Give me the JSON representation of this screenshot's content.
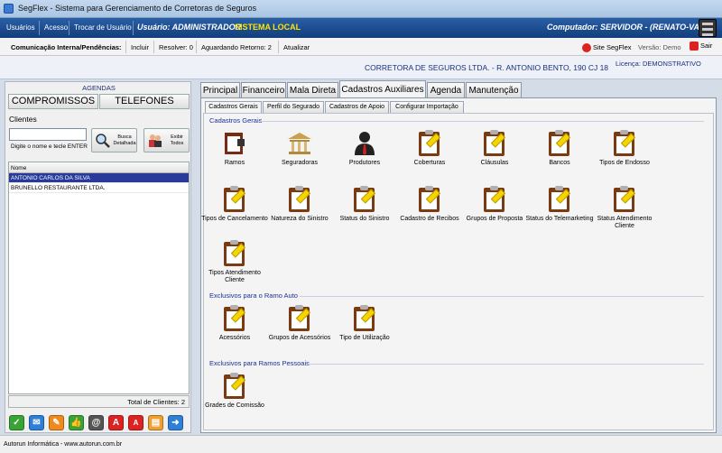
{
  "window": {
    "title": "SegFlex - Sistema para Gerenciamento de Corretoras de Seguros"
  },
  "menu": {
    "items": [
      "Usuários",
      "Acesso",
      "Trocar de Usuário"
    ],
    "user": "Usuário: ADMINISTRADOR",
    "system": "SISTEMA LOCAL",
    "computer": "Computador: SERVIDOR - (RENATO-VAIO)"
  },
  "toolbar": {
    "comm": "Comunicação Interna/Pendências:",
    "incluir": "Incluir",
    "resolver": "Resolver: 0",
    "aguardando": "Aguardando Retorno: 2",
    "atualizar": "Atualizar",
    "site": "Site SegFlex",
    "versao": "Versão: Demo",
    "sair": "Sair"
  },
  "info": {
    "company": "CORRETORA DE SEGUROS LTDA. - R. ANTONIO BENTO, 190 CJ 18",
    "license": "Licença: DEMONSTRATIVO"
  },
  "left": {
    "agendas": "AGENDAS",
    "compromissos": "COMPROMISSOS",
    "telefones": "TELEFONES",
    "clientes": "Clientes",
    "search_hint": "Digite o nome e tecle ENTER",
    "busca": "Busca Detalhada",
    "exibir": "Exibir Todos",
    "col_nome": "Nome",
    "rows": [
      "ANTONIO CARLOS DA SILVA",
      "BRUNELLO RESTAURANTE LTDA."
    ],
    "total": "Total de Clientes: 2"
  },
  "tabs": [
    "Principal",
    "Financeiro",
    "Mala Direta",
    "Cadastros Auxiliares",
    "Agenda",
    "Manutenção"
  ],
  "subtabs": [
    "Cadastros Gerais",
    "Perfil do Segurado",
    "Cadastros de Apoio",
    "Configurar Importação"
  ],
  "sections": {
    "gerais": "Cadastros Gerais",
    "auto": "Exclusivos para o Ramo Auto",
    "pessoais": "Exclusivos para Ramos Pessoais"
  },
  "items": {
    "ramos": "Ramos",
    "seguradoras": "Seguradoras",
    "produtores": "Produtores",
    "coberturas": "Coberturas",
    "clausulas": "Cláusulas",
    "bancos": "Bancos",
    "tipos_endosso": "Tipos de Endosso",
    "tipos_cancel": "Tipos de Cancelamento",
    "natureza": "Natureza do Sinistro",
    "status_sinistro": "Status do Sinistro",
    "cad_recibos": "Cadastro de Recibos",
    "grupos_proposta": "Grupos de Proposta",
    "status_tele": "Status do Telemarketing",
    "status_atend": "Status Atendimento Cliente",
    "tipos_atend": "Tipos Atendimento Cliente",
    "acessorios": "Acessórios",
    "grupos_acess": "Grupos de Acessórios",
    "tipo_util": "Tipo de Utilização",
    "grades": "Grades de Comissão"
  },
  "status": "Autorun Informática - www.autorun.com.br"
}
